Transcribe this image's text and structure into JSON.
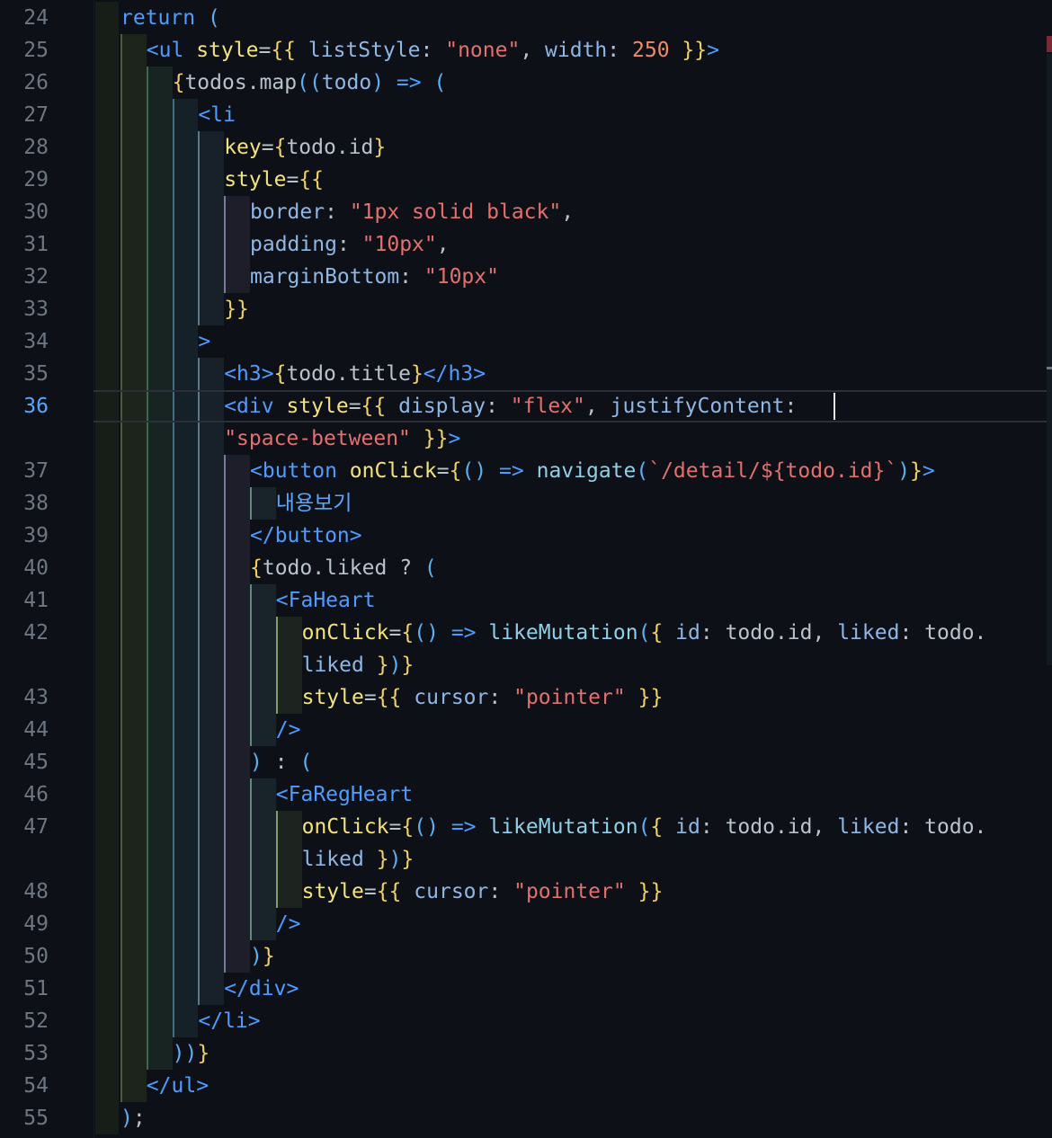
{
  "editor": {
    "active_line": "36",
    "lines": [
      {
        "n": "24",
        "t": "return ("
      },
      {
        "n": "25",
        "t": "<ul style={{ listStyle: \"none\", width: 250 }}>"
      },
      {
        "n": "26",
        "t": "{todos.map((todo) => ("
      },
      {
        "n": "27",
        "t": "<li"
      },
      {
        "n": "28",
        "t": "key={todo.id}"
      },
      {
        "n": "29",
        "t": "style={{"
      },
      {
        "n": "30",
        "t": "border: \"1px solid black\","
      },
      {
        "n": "31",
        "t": "padding: \"10px\","
      },
      {
        "n": "32",
        "t": "marginBottom: \"10px\""
      },
      {
        "n": "33",
        "t": "}}"
      },
      {
        "n": "34",
        "t": ">"
      },
      {
        "n": "35",
        "t": "<h3>{todo.title}</h3>"
      },
      {
        "n": "36",
        "t": "<div style={{ display: \"flex\", justifyContent:"
      },
      {
        "n": "",
        "t": "\"space-between\" }}>"
      },
      {
        "n": "37",
        "t": "<button onClick={() => navigate(`/detail/${todo.id}`)}>"
      },
      {
        "n": "38",
        "t": "내용보기"
      },
      {
        "n": "39",
        "t": "</button>"
      },
      {
        "n": "40",
        "t": "{todo.liked ? ("
      },
      {
        "n": "41",
        "t": "<FaHeart"
      },
      {
        "n": "42",
        "t": "onClick={() => likeMutation({ id: todo.id, liked: todo."
      },
      {
        "n": "",
        "t": "liked })}"
      },
      {
        "n": "43",
        "t": "style={{ cursor: \"pointer\" }}"
      },
      {
        "n": "44",
        "t": "/>"
      },
      {
        "n": "45",
        "t": ") : ("
      },
      {
        "n": "46",
        "t": "<FaRegHeart"
      },
      {
        "n": "47",
        "t": "onClick={() => likeMutation({ id: todo.id, liked: todo."
      },
      {
        "n": "",
        "t": "liked })}"
      },
      {
        "n": "48",
        "t": "style={{ cursor: \"pointer\" }}"
      },
      {
        "n": "49",
        "t": "/>"
      },
      {
        "n": "50",
        "t": ")}"
      },
      {
        "n": "51",
        "t": "</div>"
      },
      {
        "n": "52",
        "t": "</li>"
      },
      {
        "n": "53",
        "t": "))}"
      },
      {
        "n": "54",
        "t": "</ul>"
      },
      {
        "n": "55",
        "t": ");"
      }
    ]
  }
}
